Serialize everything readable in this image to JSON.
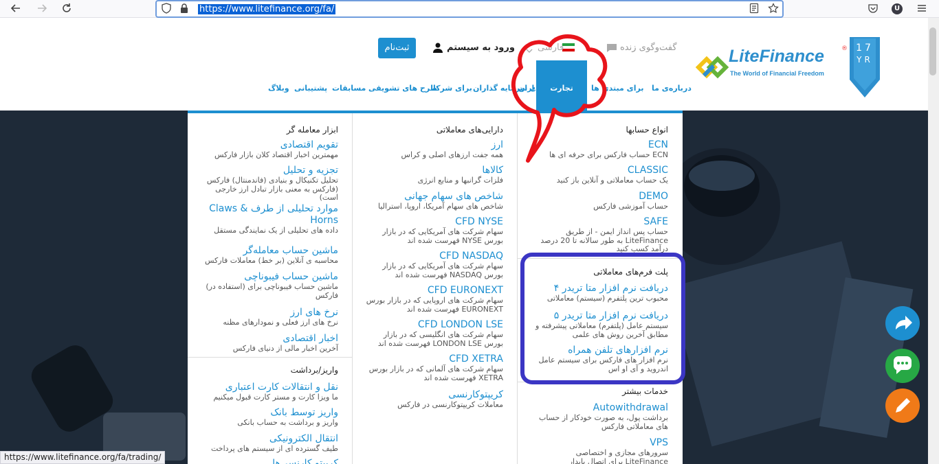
{
  "browser": {
    "url": "https://www.litefinance.org/fa/",
    "status_url": "https://www.litefinance.org/fa/trading/",
    "profile_initial": "U"
  },
  "header": {
    "badge_top": "17",
    "badge_bottom": "YR",
    "logo_text": "LiteFinance",
    "logo_sub": "The World of Financial Freedom",
    "logo_reg": "®",
    "live_chat": "گفت‌وگوی زنده",
    "language": "فارسی",
    "login": "ورود به سیستم",
    "register": "ثبت‌نام"
  },
  "menu": {
    "about": "درباره‌ی ما",
    "beginners": "برای مبتدی ها",
    "trading": "تجارت فارکس",
    "investors": "برای سرمایه گذاران",
    "partners": "برای شرکا",
    "bonuses": "طرح های تشویقی",
    "contests": "مسابقات",
    "support": "پشتیبانی",
    "blog": "وبلاگ"
  },
  "mega": {
    "accounts": {
      "title": "انواع حسابها",
      "items": [
        {
          "title": "ECN",
          "desc": "ECN حساب فارکس برای حرفه ای ها"
        },
        {
          "title": "CLASSIC",
          "desc": "یک حساب معاملاتی و آنلاین باز کنید"
        },
        {
          "title": "DEMO",
          "desc": "حساب آموزشی فارکس"
        },
        {
          "title": "SAFE",
          "desc": "حساب پس انداز ایمن - از طریق LiteFinance به طور سالانه تا 20 درصد درآمد کسب کنید"
        }
      ]
    },
    "platforms": {
      "title": "پلت فرم‌های معاملاتی",
      "items": [
        {
          "title": "دریافت نرم افزار متا تریدر ۴",
          "desc": "محبوب ترین پلتفرم (سیستم) معاملاتی"
        },
        {
          "title": "دریافت نرم افزار متا تریدر ۵",
          "desc": "سیستم عامل (پلتفرم) معاملاتی پیشرفته و مطابق آخرین روش های علمی"
        },
        {
          "title": "نرم افزارهای تلفن همراه",
          "desc": "نرم افزار های فارکس برای سیستم عامل اندروید و آی او اس"
        }
      ]
    },
    "services": {
      "title": "خدمات بیشتر",
      "items": [
        {
          "title": "Autowithdrawal",
          "desc": "برداشت پول، به صورت خودکار از حساب های معاملاتی فارکس"
        },
        {
          "title": "VPS",
          "desc": "سرورهای مجازی و اختصاصی LiteFinance برای اتصال پایدار"
        }
      ]
    },
    "assets": {
      "title": "دارایی‌های معاملاتی",
      "items": [
        {
          "title": "ارز",
          "desc": "همه جفت ارزهای اصلی و کراس"
        },
        {
          "title": "کالاها",
          "desc": "فلزات گرانبها و منابع انرژی"
        },
        {
          "title": "شاخص های سهام جهانی",
          "desc": "شاخص های سهام آمریکا، اروپا، استرالیا"
        },
        {
          "title": "CFD NYSE",
          "desc": "سهام شرکت های آمریکایی که در بازار بورس NYSE فهرست شده اند"
        },
        {
          "title": "CFD NASDAQ",
          "desc": "سهام شرکت های آمریکایی که در بازار بورس NASDAQ فهرست شده اند"
        },
        {
          "title": "CFD EURONEXT",
          "desc": "سهام شرکت های اروپایی که در بازار بورس EURONEXT فهرست شده اند"
        },
        {
          "title": "CFD LONDON LSE",
          "desc": "سهام شرکت های انگلیسی که در بازار بورس LONDON LSE فهرست شده اند"
        },
        {
          "title": "CFD XETRA",
          "desc": "سهام شرکت های آلمانی که در بازار بورس XETRA فهرست شده اند"
        },
        {
          "title": "کریپتوکارنسی",
          "desc": "معاملات کریپتوکارنسی در فارکس"
        }
      ]
    },
    "tools": {
      "title": "ابزار معامله گر",
      "items": [
        {
          "title": "تقویم اقتصادی",
          "desc": "مهمترین اخبار اقتصاد کلان بازار فارکس"
        },
        {
          "title": "تجزیه و تحلیل",
          "desc": "تحلیل تکنیکال و بنیادی (فاندمنتال) فارکس (فارکس به معنی بازار تبادل ارز خارجی است)"
        },
        {
          "title": "موارد تحلیلی از طرف Claws & Horns",
          "desc": "داده های تحلیلی از یک نمایندگی مستقل"
        },
        {
          "title": "ماشین حساب معامله‌گر",
          "desc": "محاسبه ی آنلاین (بر خط) معاملات فارکس"
        },
        {
          "title": "ماشین حساب فیبوناچی",
          "desc": "ماشین حساب فیبوناچی برای (استفاده در) فارکس"
        },
        {
          "title": "نرخ های ارز",
          "desc": "نرخ های ارز فعلی و نمودارهای مظنه"
        },
        {
          "title": "اخبار اقتصادی",
          "desc": "آخرین اخبار مالی از دنیای فارکس"
        }
      ]
    },
    "deposit": {
      "title": "واریز/برداشت",
      "items": [
        {
          "title": "نقل و انتقالات کارت اعتباری",
          "desc": "ما ویزا کارت و مستر کارت قبول میکنیم"
        },
        {
          "title": "واریز توسط بانک",
          "desc": "واریز و برداشت به حساب بانکی"
        },
        {
          "title": "انتقال الکترونیکی",
          "desc": "طیف گسترده ای از سیستم های پرداخت"
        },
        {
          "title": "کریپتو کارنسی‌ها",
          "desc": ""
        }
      ]
    }
  },
  "colors": {
    "brand_blue": "#1d8fd0",
    "annotation_red": "#e8141b",
    "annotation_indigo": "#3b36c4",
    "share_fab": "#1d8fd0",
    "chat_fab": "#27a845",
    "edit_fab": "#f07a18"
  },
  "icons": {
    "back": "arrow-left-icon",
    "forward": "arrow-right-icon",
    "reload": "reload-icon",
    "share": "share-arrow-icon",
    "chat": "chat-bubble-icon",
    "edit": "pencil-icon"
  }
}
